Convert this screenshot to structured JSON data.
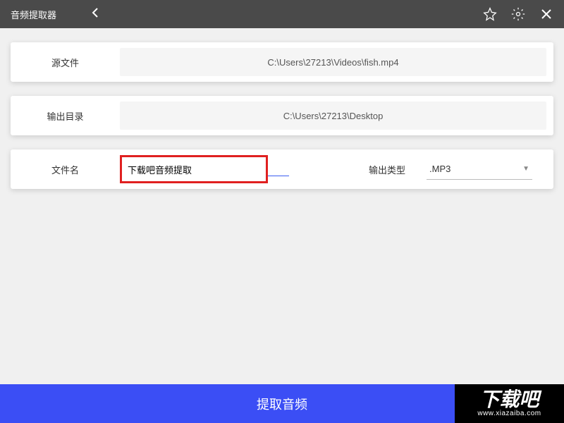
{
  "titlebar": {
    "title": "音频提取器"
  },
  "source": {
    "label": "源文件",
    "path": "C:\\Users\\27213\\Videos\\fish.mp4"
  },
  "output": {
    "label": "输出目录",
    "path": "C:\\Users\\27213\\Desktop"
  },
  "filename": {
    "label": "文件名",
    "value": "下载吧音频提取"
  },
  "outputType": {
    "label": "输出类型",
    "value": ".MP3"
  },
  "extractButton": "提取音频",
  "watermark": {
    "brand": "下载吧",
    "url": "www.xiazaiba.com"
  }
}
